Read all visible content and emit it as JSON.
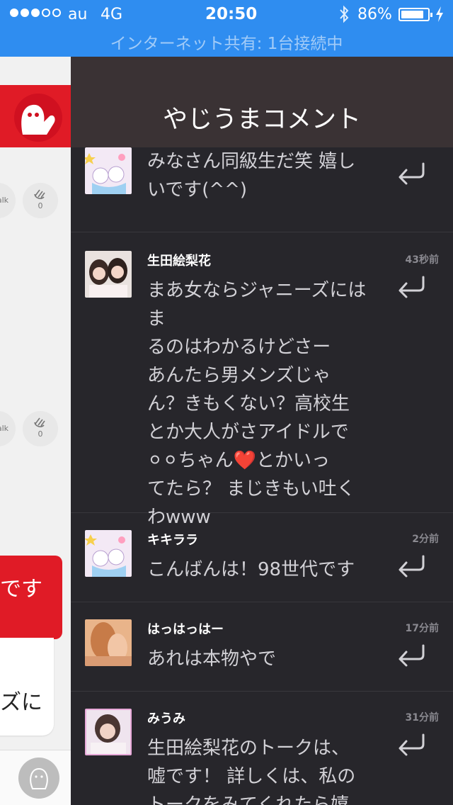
{
  "status_bar": {
    "carrier": "au",
    "network": "4G",
    "time": "20:50",
    "battery": "86%",
    "battery_level": 0.86,
    "tethering": "インターネット共有: 1台接続中",
    "bg_color": "#2f8df0"
  },
  "left_panel": {
    "talk_label": "alk",
    "clap_count_1": "0",
    "clap_count_2": "0",
    "bubble_red_text": "です",
    "bubble_white_text": "ズに"
  },
  "drawer": {
    "title": "やじうまコメント",
    "comments": [
      {
        "user": "",
        "time": "",
        "lines": [
          "みなさん同級生だ笑 嬉し",
          "いです(^^)"
        ],
        "avatar": "cartoon-stars"
      },
      {
        "user": "生田絵梨花",
        "time": "43秒前",
        "lines": [
          "まあ女ならジャニーズにはま",
          "るのはわかるけどさー",
          "あんたら男メンズじゃ",
          "ん？きもくない？高校生",
          "とか大人がさアイドルで",
          "⚪⚪ちゃん❤️とかいっ",
          "てたら？ まじきもい吐く",
          "わwww"
        ],
        "avatar": "two-girls-photo"
      },
      {
        "user": "キキララ",
        "time": "2分前",
        "lines": [
          "こんばんは！98世代です"
        ],
        "avatar": "cartoon-stars"
      },
      {
        "user": "はっはっはー",
        "time": "17分前",
        "lines": [
          "あれは本物やで"
        ],
        "avatar": "photo-blurred"
      },
      {
        "user": "みうみ",
        "time": "31分前",
        "lines": [
          "生田絵梨花のトークは、",
          "嘘です！ 詳しくは、私の",
          "トークをみてくれたら嬉"
        ],
        "avatar": "photo-girl"
      }
    ]
  },
  "colors": {
    "drawer_bg": "#27262b",
    "header_bg": "#3a3234",
    "accent_red": "#e01b26"
  }
}
